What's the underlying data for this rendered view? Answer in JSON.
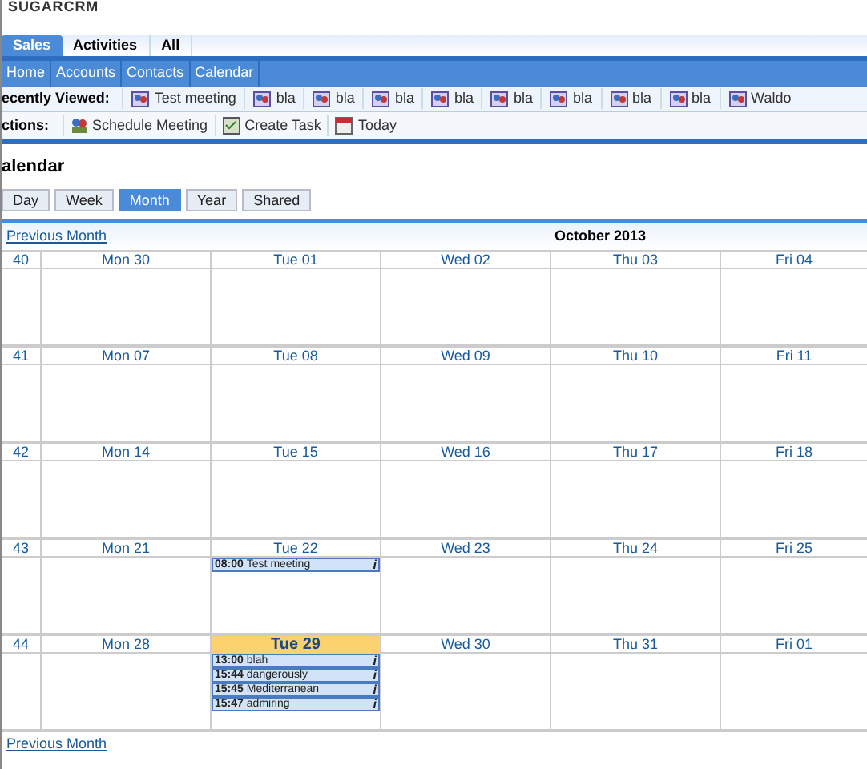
{
  "logo": "SUGARCRM",
  "module_tabs": [
    {
      "label": "Sales",
      "selected": true
    },
    {
      "label": "Activities",
      "selected": false
    },
    {
      "label": "All",
      "selected": false
    }
  ],
  "nav": [
    {
      "label": "Home"
    },
    {
      "label": "Accounts"
    },
    {
      "label": "Contacts"
    },
    {
      "label": "Calendar"
    }
  ],
  "recently_viewed": {
    "label": "ecently Viewed:",
    "items": [
      "Test meeting",
      "bla",
      "bla",
      "bla",
      "bla",
      "bla",
      "bla",
      "bla",
      "bla",
      "Waldo"
    ]
  },
  "actions": {
    "label": "ctions:",
    "items": [
      {
        "kind": "meeting",
        "label": "Schedule Meeting"
      },
      {
        "kind": "task",
        "label": "Create Task"
      },
      {
        "kind": "calendar",
        "label": "Today"
      }
    ]
  },
  "page_title": "alendar",
  "views": [
    {
      "label": "Day",
      "selected": false
    },
    {
      "label": "Week",
      "selected": false
    },
    {
      "label": "Month",
      "selected": true
    },
    {
      "label": "Year",
      "selected": false
    },
    {
      "label": "Shared",
      "selected": false
    }
  ],
  "previous_link": "Previous Month",
  "month_title": "October 2013",
  "weeks": [
    {
      "number": "40",
      "days": [
        {
          "label": "Mon 30",
          "today": false
        },
        {
          "label": "Tue 01",
          "today": false
        },
        {
          "label": "Wed 02",
          "today": false
        },
        {
          "label": "Thu 03",
          "today": false
        },
        {
          "label": "Fri 04",
          "today": false
        }
      ]
    },
    {
      "number": "41",
      "days": [
        {
          "label": "Mon 07",
          "today": false
        },
        {
          "label": "Tue 08",
          "today": false
        },
        {
          "label": "Wed 09",
          "today": false
        },
        {
          "label": "Thu 10",
          "today": false
        },
        {
          "label": "Fri 11",
          "today": false
        }
      ]
    },
    {
      "number": "42",
      "days": [
        {
          "label": "Mon 14",
          "today": false
        },
        {
          "label": "Tue 15",
          "today": false
        },
        {
          "label": "Wed 16",
          "today": false
        },
        {
          "label": "Thu 17",
          "today": false
        },
        {
          "label": "Fri 18",
          "today": false
        }
      ]
    },
    {
      "number": "43",
      "days": [
        {
          "label": "Mon 21",
          "today": false
        },
        {
          "label": "Tue 22",
          "today": false,
          "events": [
            {
              "time": "08:00",
              "title": "Test meeting",
              "info": "i"
            }
          ]
        },
        {
          "label": "Wed 23",
          "today": false
        },
        {
          "label": "Thu 24",
          "today": false
        },
        {
          "label": "Fri 25",
          "today": false
        }
      ]
    },
    {
      "number": "44",
      "days": [
        {
          "label": "Mon 28",
          "today": false
        },
        {
          "label": "Tue 29",
          "today": true,
          "events": [
            {
              "time": "13:00",
              "title": "blah",
              "info": "i"
            },
            {
              "time": "15:44",
              "title": "dangerously",
              "info": "i"
            },
            {
              "time": "15:45",
              "title": "Mediterranean",
              "info": "i"
            },
            {
              "time": "15:47",
              "title": "admiring",
              "info": "i"
            }
          ]
        },
        {
          "label": "Wed 30",
          "today": false
        },
        {
          "label": "Thu 31",
          "today": false
        },
        {
          "label": "Fri 01",
          "today": false
        }
      ]
    }
  ],
  "bottom_link": "Previous Month"
}
